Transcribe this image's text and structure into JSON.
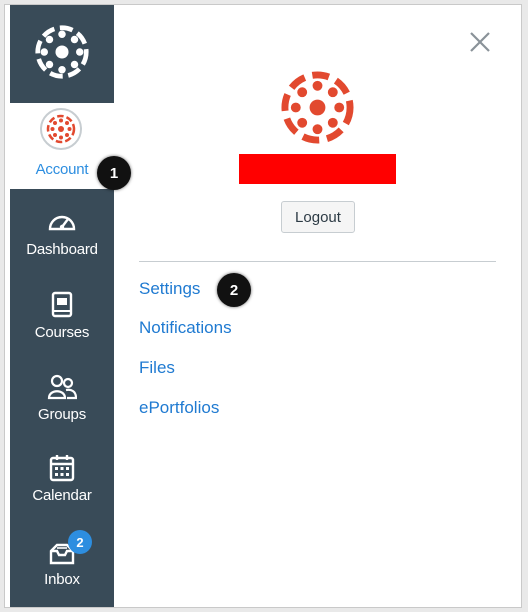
{
  "nav": {
    "account_label": "Account",
    "items": [
      {
        "label": "Dashboard",
        "icon": "dashboard-icon"
      },
      {
        "label": "Courses",
        "icon": "courses-icon"
      },
      {
        "label": "Groups",
        "icon": "groups-icon"
      },
      {
        "label": "Calendar",
        "icon": "calendar-icon"
      },
      {
        "label": "Inbox",
        "icon": "inbox-icon",
        "badge": "2"
      }
    ]
  },
  "tray": {
    "logout_label": "Logout",
    "links": [
      "Settings",
      "Notifications",
      "Files",
      "ePortfolios"
    ]
  },
  "steps": [
    "1",
    "2"
  ],
  "colors": {
    "nav_bg": "#394b58",
    "brand_red": "#e2492f",
    "link_blue": "#1f7ad1",
    "badge_blue": "#2d8ee0",
    "redaction": "#ff0000"
  }
}
